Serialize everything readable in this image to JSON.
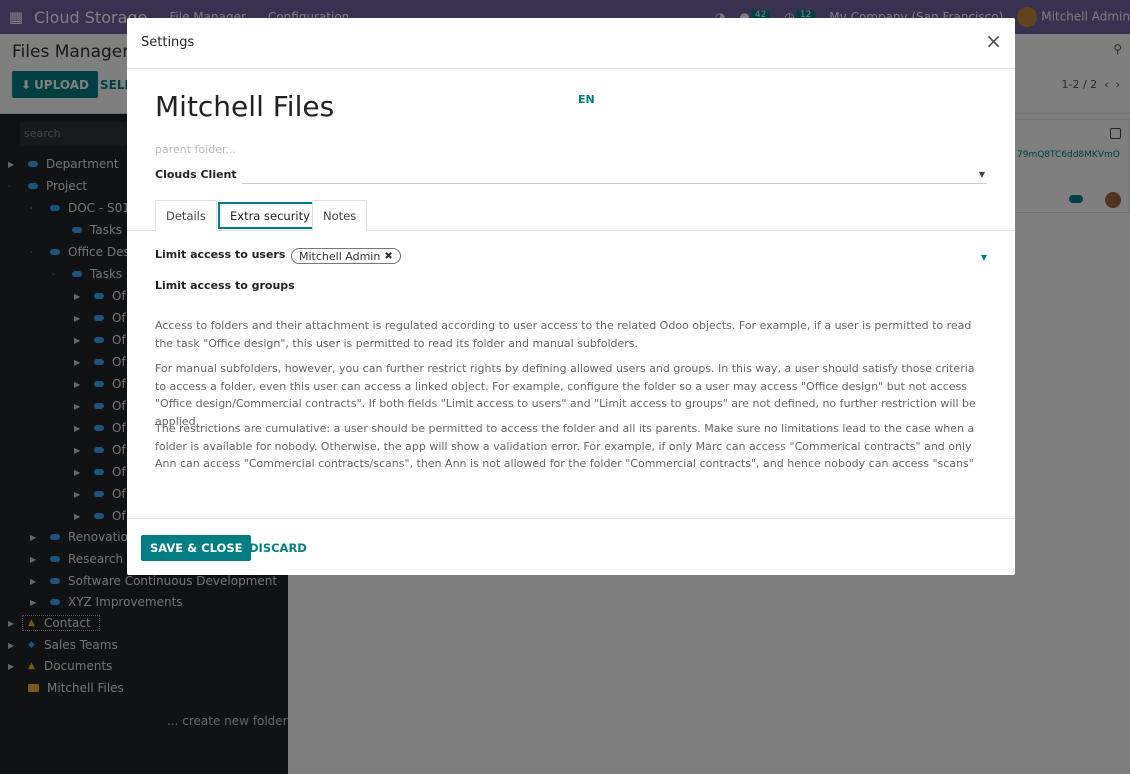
{
  "navbar": {
    "app_name": "Cloud Storage",
    "menu": [
      "File Manager",
      "Configuration"
    ],
    "messages_count": "42",
    "activities_count": "12",
    "company": "My Company (San Francisco)",
    "user": "Mitchell Admin"
  },
  "control_panel": {
    "title": "Files Manager",
    "upload_label": "UPLOAD",
    "select_label": "SELE",
    "pager": "1-2 / 2"
  },
  "sidebar": {
    "search_placeholder": "search",
    "items": [
      {
        "label": "Department"
      },
      {
        "label": "Project"
      },
      {
        "label": "DOC - S014"
      },
      {
        "label": "Tasks"
      },
      {
        "label": "Office Des"
      },
      {
        "label": "Tasks"
      },
      {
        "label": "Of"
      },
      {
        "label": "Of"
      },
      {
        "label": "Of"
      },
      {
        "label": "Of"
      },
      {
        "label": "Of"
      },
      {
        "label": "Of"
      },
      {
        "label": "Of"
      },
      {
        "label": "Of"
      },
      {
        "label": "Of"
      },
      {
        "label": "Of"
      },
      {
        "label": "Of"
      },
      {
        "label": "Renovation"
      },
      {
        "label": "Research - "
      },
      {
        "label": "Software Continuous Development"
      },
      {
        "label": "XYZ Improvements"
      },
      {
        "label": "Contact"
      },
      {
        "label": "Sales Teams"
      },
      {
        "label": "Documents"
      },
      {
        "label": "Mitchell Files"
      }
    ],
    "create_folder": "... create new folder"
  },
  "card": {
    "text": "79mQ8TC6dd8MKVmO"
  },
  "modal": {
    "title": "Settings",
    "close_label": "×",
    "record_name": "Mitchell Files",
    "lang": "EN",
    "parent_placeholder": "parent folder...",
    "clouds_client_label": "Clouds Client",
    "tabs": [
      "Details",
      "Extra security",
      "Notes"
    ],
    "limit_users_label": "Limit access to users",
    "limit_users_tag": "Mitchell Admin",
    "limit_groups_label": "Limit access to groups",
    "help": [
      "Access to folders and their attachment is regulated according to user access to the related Odoo objects. For example, if a user is permitted to read the task \"Office design\", this user is permitted to read its folder and manual subfolders.",
      "For manual subfolders, however, you can further restrict rights by defining allowed users and groups. In this way, a user should satisfy those criteria to access a folder, even this user can access a linked object. For example, configure the folder so a user may access \"Office design\" but not access \"Office design/Commercial contracts\". If both fields \"Limit access to users\" and \"Limit access to groups\" are not defined, no further restriction will be applied.",
      "The restrictions are cumulative: a user should be permitted to access the folder and all its parents. Make sure no limitations lead to the case when a folder is available for nobody. Otherwise, the app will show a validation error. For example, if only Marc can access \"Commerical contracts\" and only Ann can access \"Commercial contracts/scans\", then Ann is not allowed for the folder \"Commercial contracts\", and hence nobody can access \"scans\""
    ],
    "save_label": "SAVE & CLOSE",
    "discard_label": "DISCARD"
  },
  "colors": {
    "navbar": "#71639e",
    "accent": "#017e84",
    "sidebar": "#212529"
  }
}
